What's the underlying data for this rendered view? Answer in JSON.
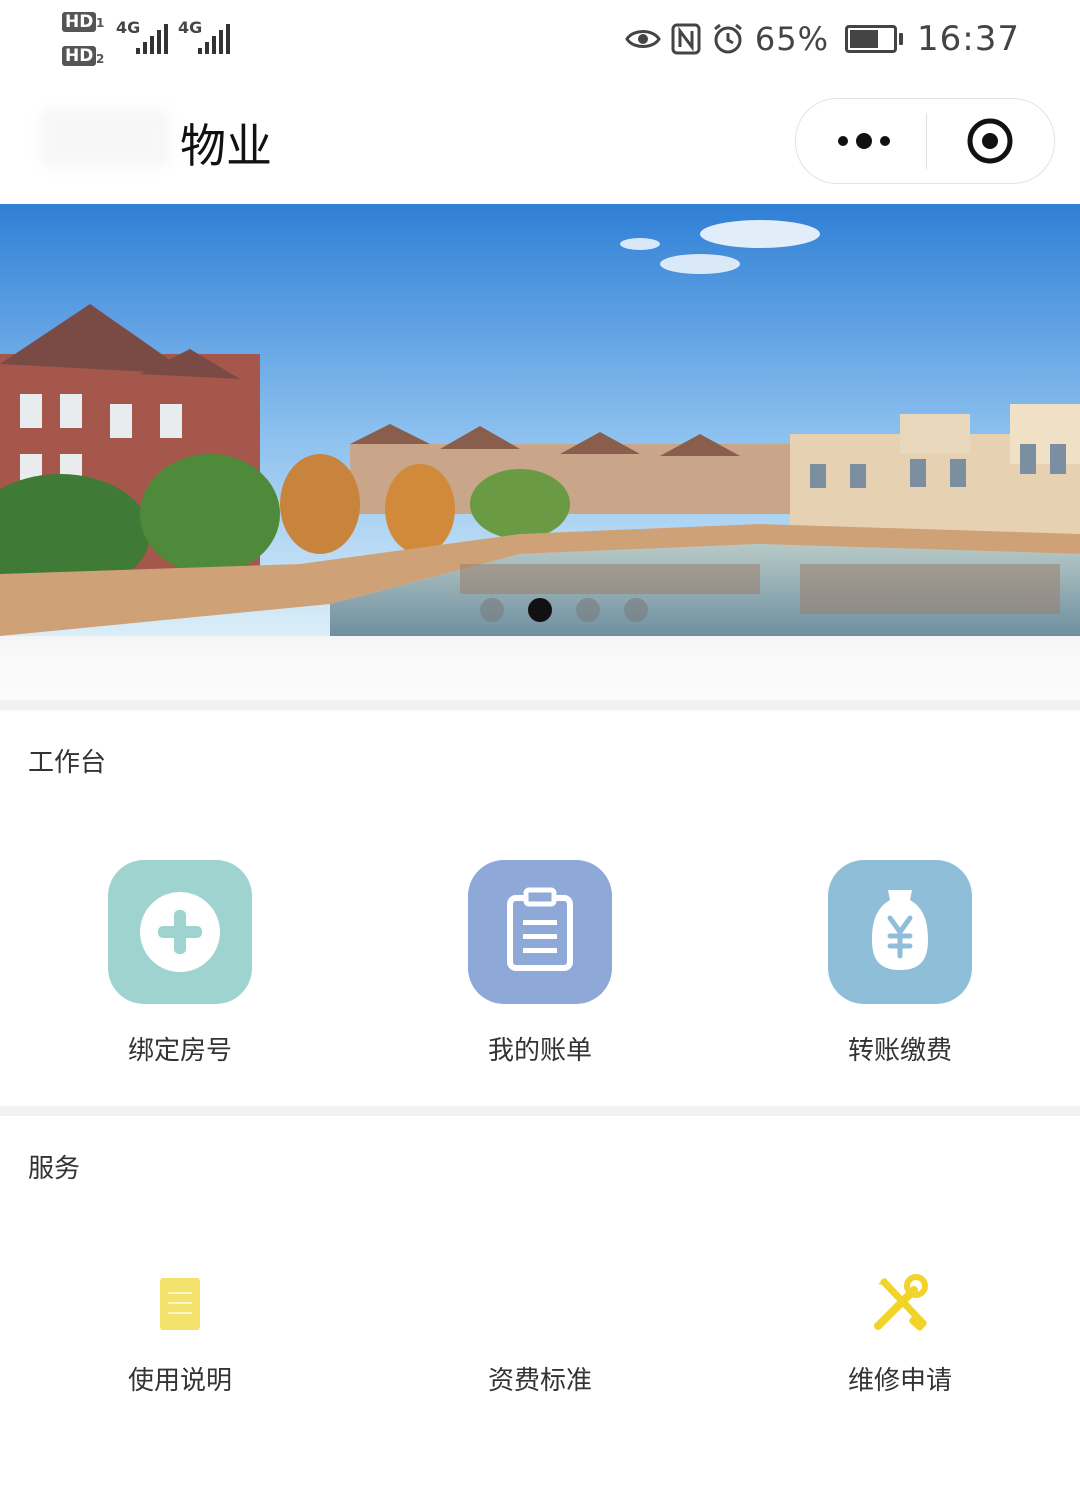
{
  "statusbar": {
    "hd1": "HD",
    "sim1": "1",
    "hd2": "HD",
    "sim2": "2",
    "net1": "4G",
    "net2": "4G",
    "battery_pct": "65%",
    "time": "16:37"
  },
  "nav": {
    "title": "物业"
  },
  "banner": {
    "slides_count": 4,
    "active_index": 1
  },
  "workbench": {
    "title": "工作台",
    "items": [
      {
        "label": "绑定房号",
        "icon": "plus-circle-icon",
        "color": "#9ed3cf"
      },
      {
        "label": "我的账单",
        "icon": "clipboard-icon",
        "color": "#8ea8d8"
      },
      {
        "label": "转账缴费",
        "icon": "money-bag-icon",
        "color": "#8fbfd8"
      }
    ]
  },
  "services": {
    "title": "服务",
    "items": [
      {
        "label": "使用说明",
        "icon": "document-icon",
        "color": "#f3e26b"
      },
      {
        "label": "资费标准",
        "icon": "",
        "color": ""
      },
      {
        "label": "维修申请",
        "icon": "tools-icon",
        "color": "#f2d32a"
      }
    ]
  }
}
